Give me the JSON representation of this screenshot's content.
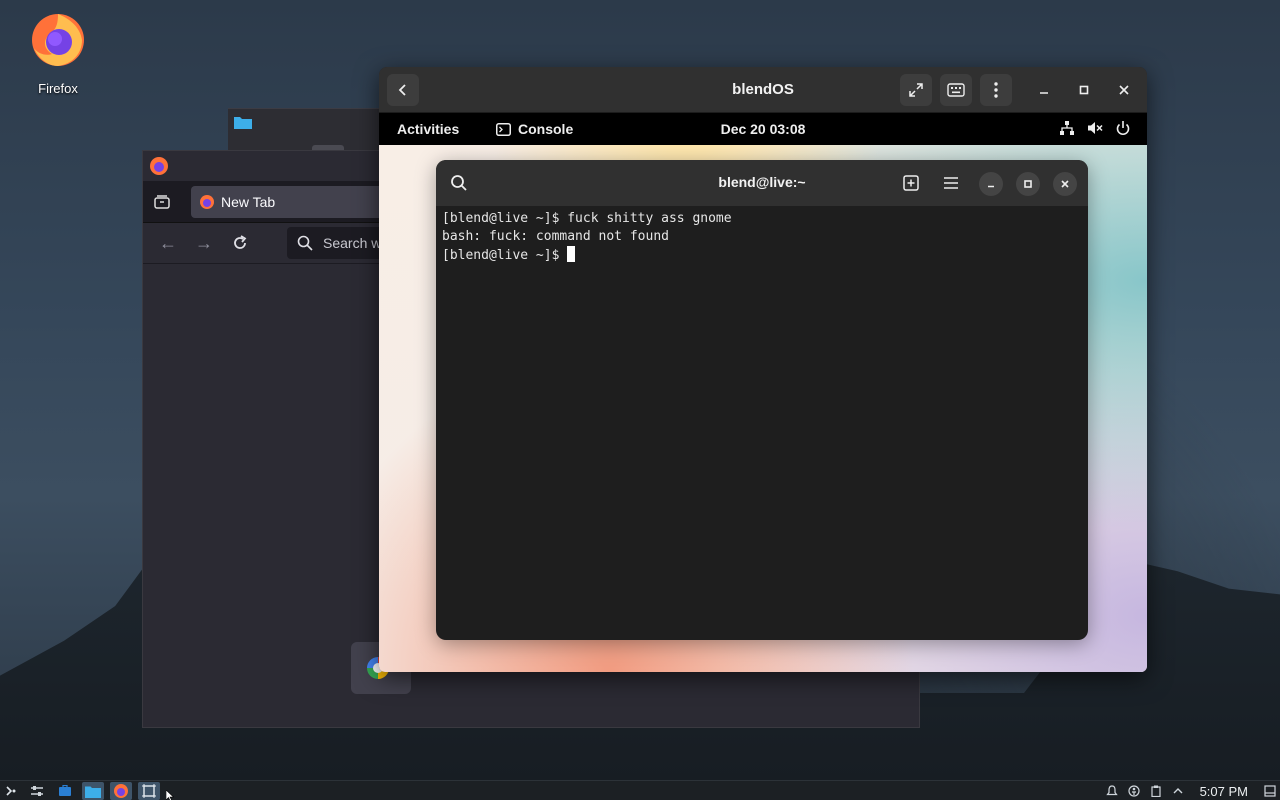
{
  "desktop": {
    "icons": [
      {
        "label": "Firefox",
        "icon": "firefox-icon"
      }
    ]
  },
  "firefox": {
    "tab_title": "New Tab",
    "url_placeholder": "Search w"
  },
  "blendos_window": {
    "title": "blendOS",
    "gnome": {
      "activities": "Activities",
      "app_name": "Console",
      "clock": "Dec 20  03:08"
    },
    "terminal": {
      "title": "blend@live:~",
      "lines": [
        "[blend@live ~]$ fuck shitty ass gnome",
        "bash: fuck: command not found",
        "[blend@live ~]$ "
      ]
    }
  },
  "taskbar": {
    "clock": "5:07 PM"
  },
  "colors": {
    "firefox_orange": "#ff7139",
    "firefox_purple": "#7542e5",
    "taskbar_active": "#3e5469"
  }
}
